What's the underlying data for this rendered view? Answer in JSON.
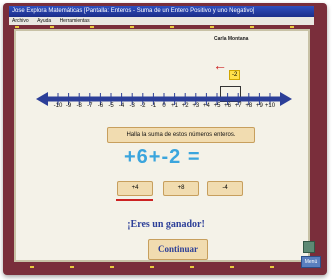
{
  "window": {
    "title": "Jose Explora Matemáticas [Pantalla: Enteros - Suma de un Entero Positivo y uno Negativo]"
  },
  "menu": [
    "Archivo",
    "Ayuda",
    "Herramientas"
  ],
  "number_line": {
    "heading": "Carla Montana",
    "marker_value": "-2",
    "ticks": [
      "-10",
      "-9",
      "-8",
      "-7",
      "-6",
      "-5",
      "-4",
      "-3",
      "-2",
      "-1",
      "0",
      "+1",
      "+2",
      "+3",
      "+4",
      "+5",
      "+6",
      "+7",
      "+8",
      "+9",
      "+10"
    ]
  },
  "prompt": "Halla la suma de estos números enteros.",
  "expression": "+6+-2 =",
  "options": [
    "+4",
    "+8",
    "-4"
  ],
  "result_message": "¡Eres un ganador!",
  "continue_label": "Continuar",
  "menu_button": "Menú",
  "colors": {
    "frame": "#7a2e3b",
    "title_bar": "#1b2d8a",
    "content_bg": "#f4f2e8",
    "accent_blue": "#2c3f98",
    "expression_blue": "#3aa5dd",
    "highlight_red": "#cc2222",
    "button_bg": "#f1dcb0"
  }
}
